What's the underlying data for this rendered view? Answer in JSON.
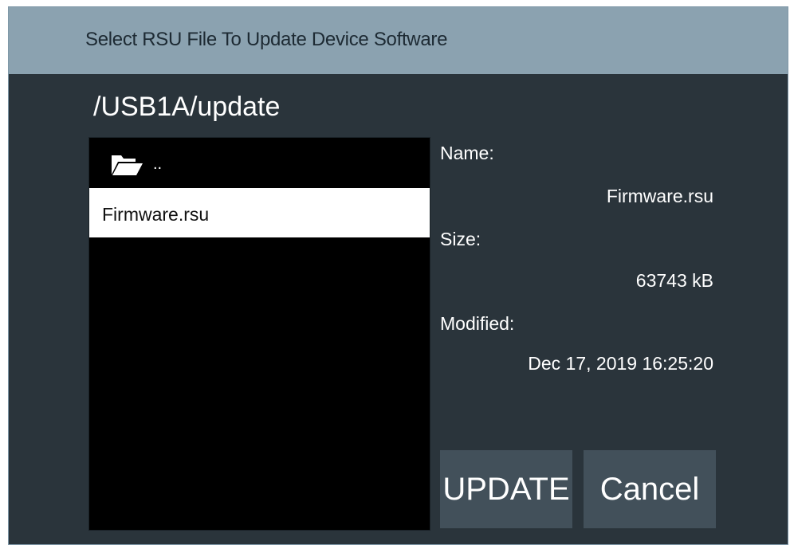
{
  "dialog": {
    "title": "Select RSU File To Update Device Software",
    "path": "/USB1A/update"
  },
  "file_list": {
    "parent_label": "..",
    "items": [
      {
        "name": "Firmware.rsu",
        "selected": true
      }
    ]
  },
  "details": {
    "name_label": "Name:",
    "name_value": "Firmware.rsu",
    "size_label": "Size:",
    "size_value": "63743 kB",
    "modified_label": "Modified:",
    "modified_value": "Dec 17, 2019 16:25:20"
  },
  "buttons": {
    "update_label": "UPDATE",
    "cancel_label": "Cancel"
  },
  "colors": {
    "titlebar": "#8ba2b0",
    "dialog_bg": "#2a343b",
    "button_bg": "#42505a",
    "list_bg": "#000000",
    "selection": "#ffffff"
  },
  "icons": {
    "parent_folder": "folder-open-icon"
  }
}
